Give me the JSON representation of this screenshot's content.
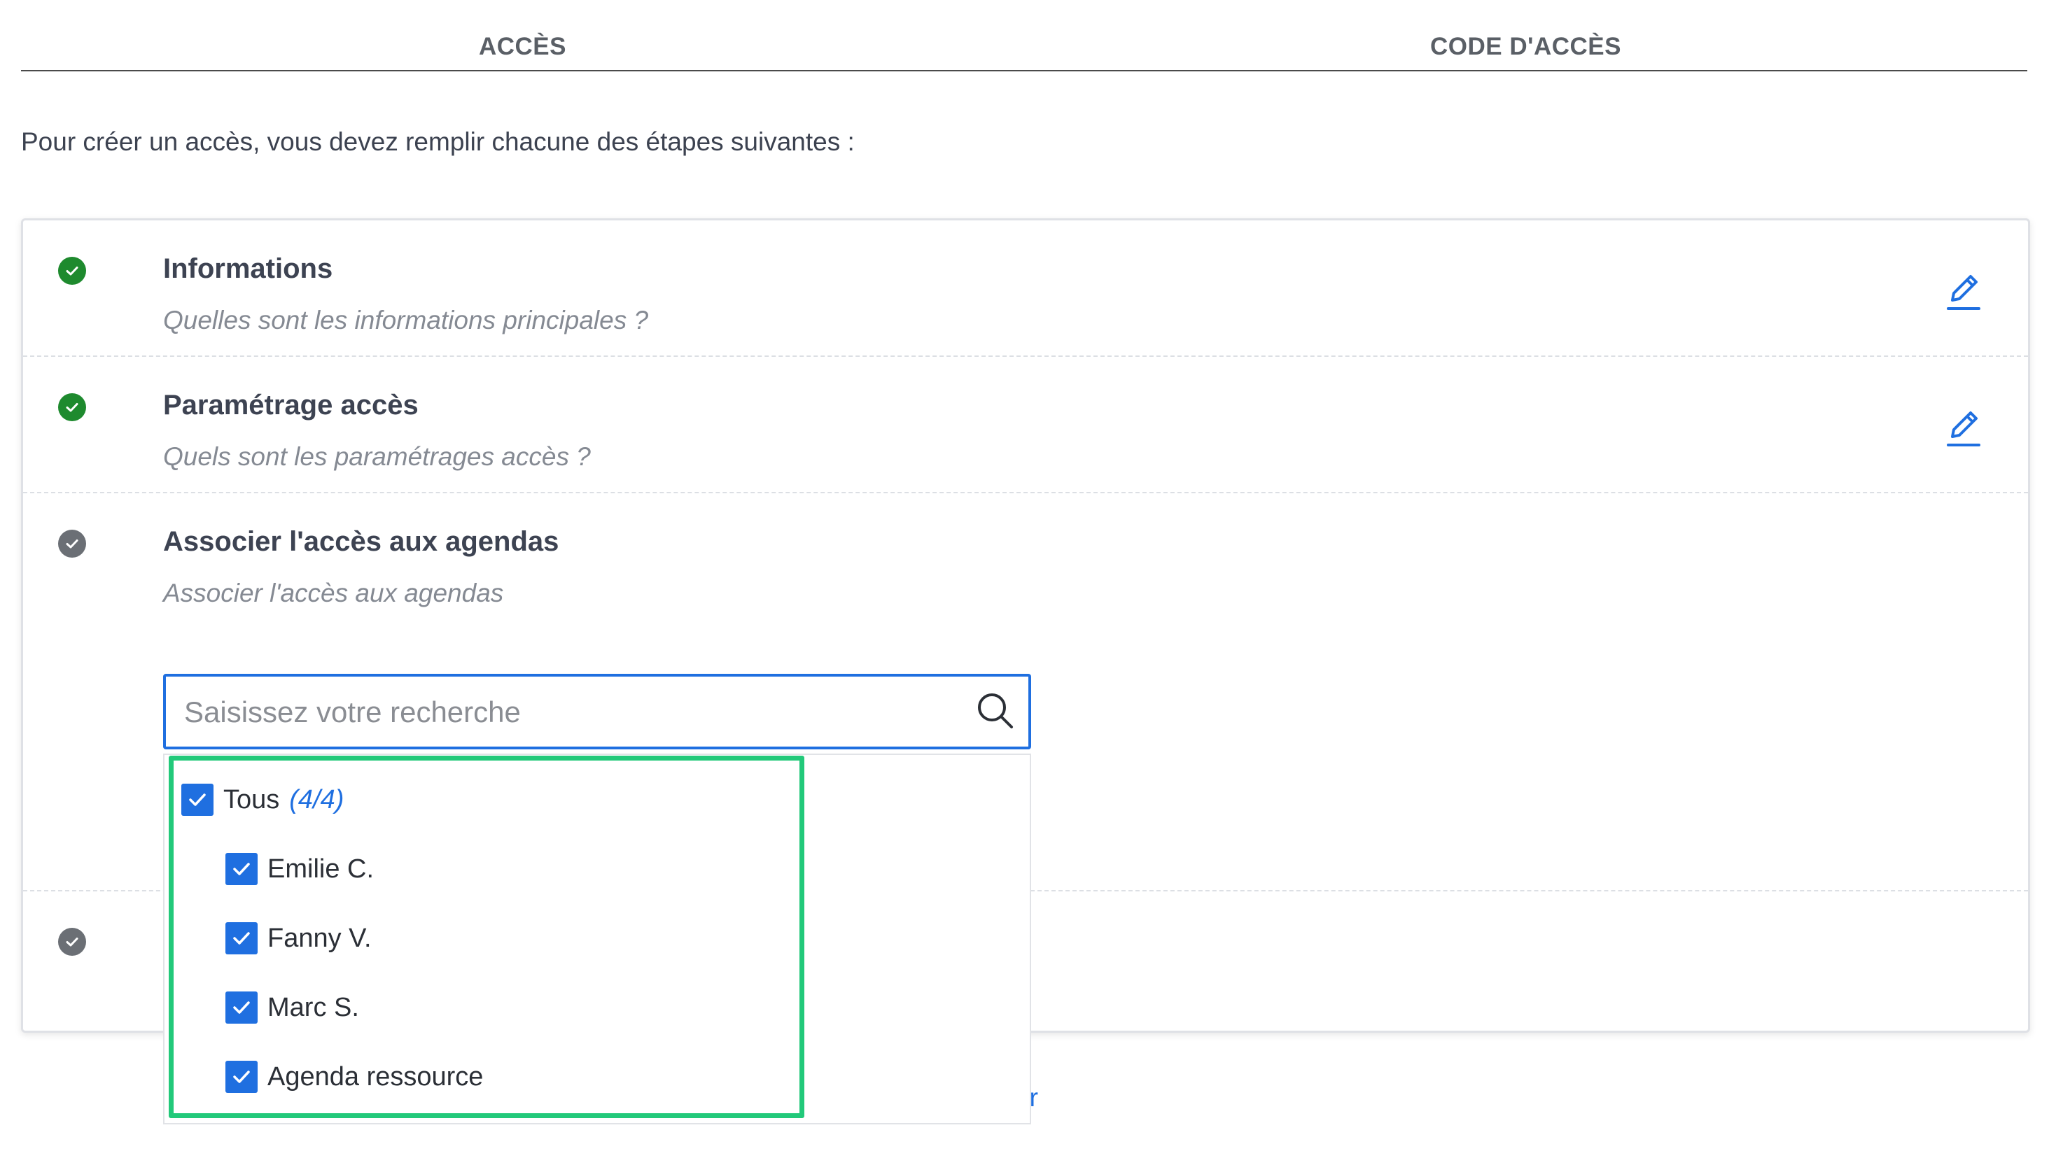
{
  "tabs": [
    {
      "label": "ACCÈS"
    },
    {
      "label": "CODE D'ACCÈS"
    }
  ],
  "intro": "Pour créer un accès, vous devez remplir chacune des étapes suivantes :",
  "steps": [
    {
      "title": "Informations",
      "subtitle": "Quelles sont les informations principales ?",
      "status": "done"
    },
    {
      "title": "Paramétrage accès",
      "subtitle": "Quels sont les paramétrages accès ?",
      "status": "done"
    },
    {
      "title": "Associer l'accès aux agendas",
      "subtitle": "Associer l'accès aux agendas",
      "status": "pending"
    },
    {
      "title": "",
      "subtitle": "",
      "status": "pending"
    }
  ],
  "search": {
    "placeholder": "Saisissez votre recherche",
    "value": ""
  },
  "dropdown": {
    "all_label": "Tous",
    "all_count": "(4/4)",
    "items": [
      {
        "label": "Emilie C.",
        "checked": true
      },
      {
        "label": "Fanny V.",
        "checked": true
      },
      {
        "label": "Marc S.",
        "checked": true
      },
      {
        "label": "Agenda ressource",
        "checked": true
      }
    ]
  },
  "partial_link": "er",
  "colors": {
    "accent": "#1f6fe0",
    "done": "#1e8a2e",
    "pending": "#6b6f75",
    "highlight": "#22c97a"
  },
  "icons": [
    "check-circle-icon",
    "pencil-edit-icon",
    "search-icon",
    "checkbox-checked-icon"
  ]
}
